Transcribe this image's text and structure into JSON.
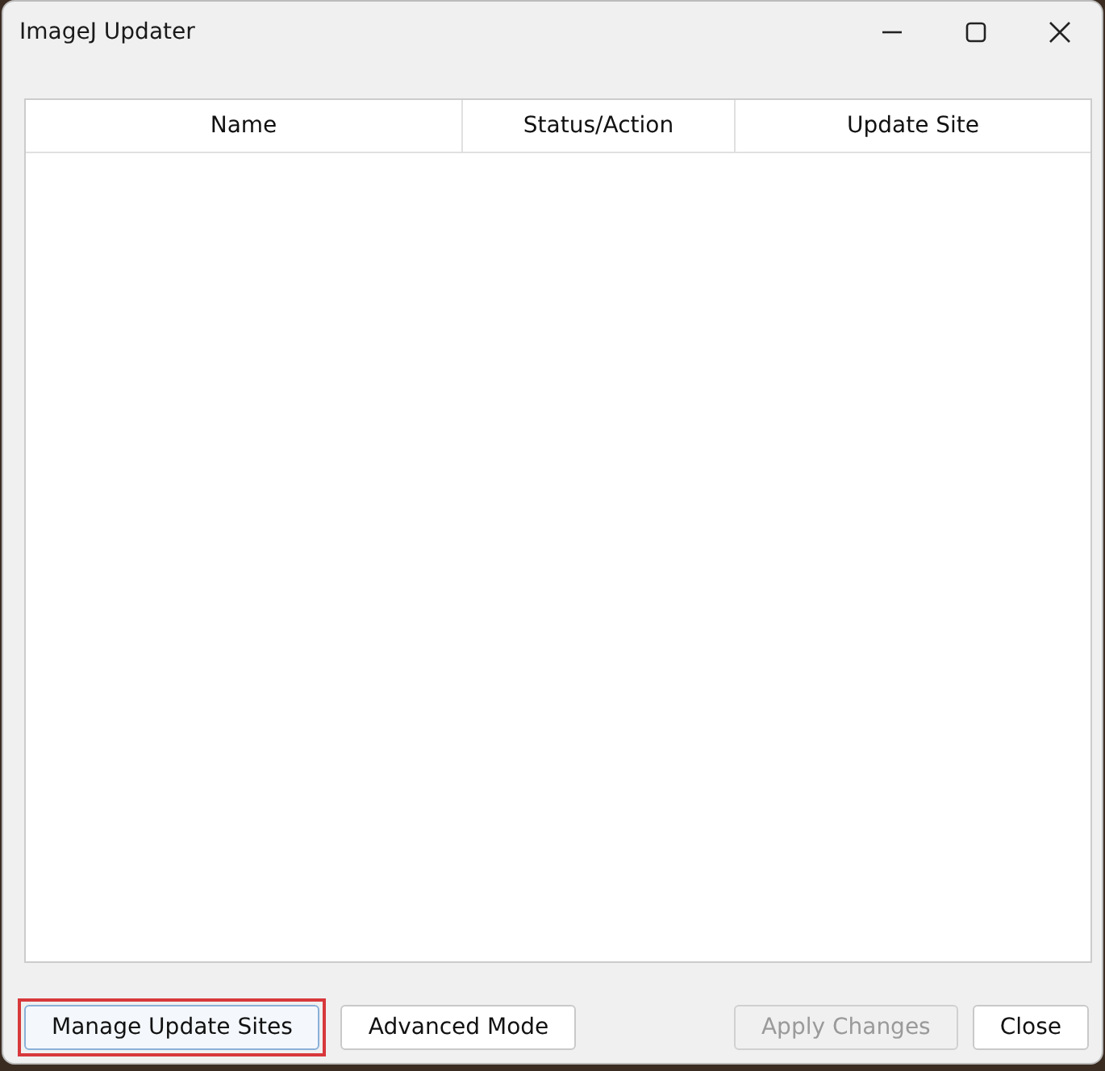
{
  "window": {
    "title": "ImageJ Updater"
  },
  "table": {
    "columns": [
      {
        "label": "Name"
      },
      {
        "label": "Status/Action"
      },
      {
        "label": "Update Site"
      }
    ]
  },
  "buttons": [
    {
      "label": "Manage Update Sites",
      "disabled": false,
      "highlighted": true
    },
    {
      "label": "Advanced Mode",
      "disabled": false,
      "highlighted": false
    },
    {
      "label": "Apply Changes",
      "disabled": true,
      "highlighted": false
    },
    {
      "label": "Close",
      "disabled": false,
      "highlighted": false
    }
  ]
}
